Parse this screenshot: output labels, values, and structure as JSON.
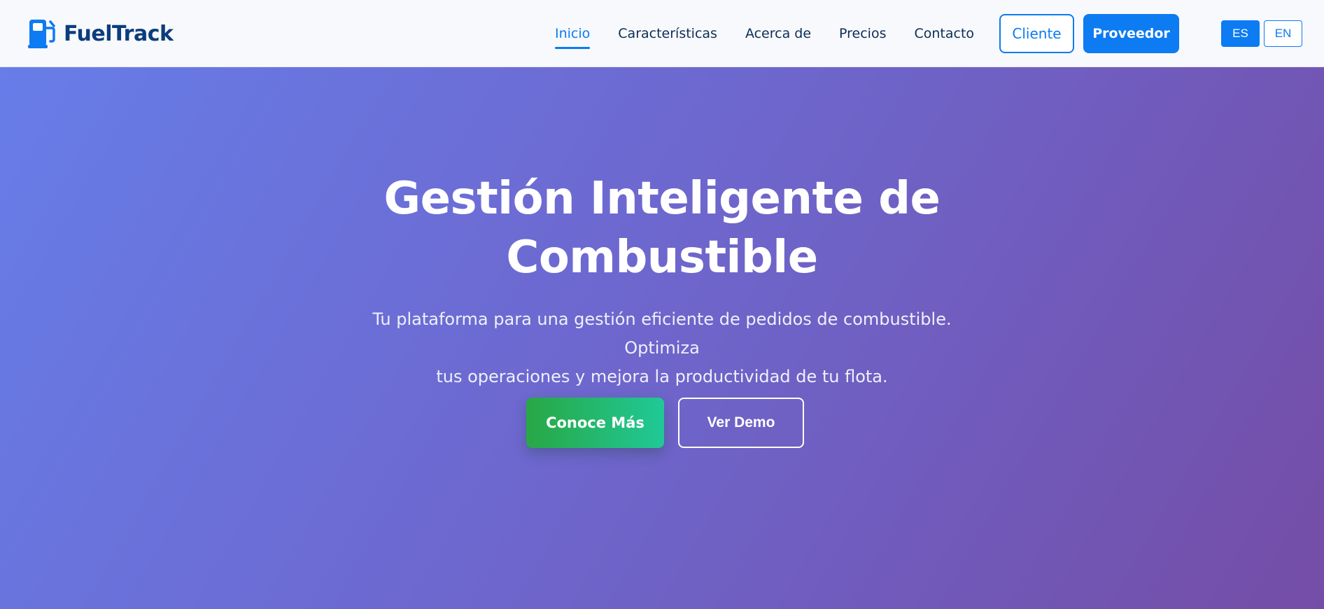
{
  "brand": {
    "name": "FuelTrack",
    "icon": "fuel-pump-icon",
    "color": "#0b3d7c"
  },
  "nav": {
    "links": [
      {
        "label": "Inicio",
        "active": true
      },
      {
        "label": "Características",
        "active": false
      },
      {
        "label": "Acerca de",
        "active": false
      },
      {
        "label": "Precios",
        "active": false
      },
      {
        "label": "Contacto",
        "active": false
      }
    ],
    "cliente_label": "Cliente",
    "proveedor_label": "Proveedor",
    "languages": [
      {
        "label": "ES",
        "selected": true
      },
      {
        "label": "EN",
        "selected": false
      }
    ]
  },
  "hero": {
    "title_line1": "Gestión Inteligente de",
    "title_line2": "Combustible",
    "subtitle_line1": "Tu plataforma para una gestión eficiente de pedidos de combustible. Optimiza",
    "subtitle_line2": "tus operaciones y mejora la productividad de tu flota.",
    "primary_cta": "Conoce Más",
    "secondary_cta": "Ver Demo"
  },
  "colors": {
    "accent": "#0d7bf2",
    "hero_gradient_start": "#677de8",
    "hero_gradient_end": "#744da7",
    "cta_green": "#28a745"
  }
}
